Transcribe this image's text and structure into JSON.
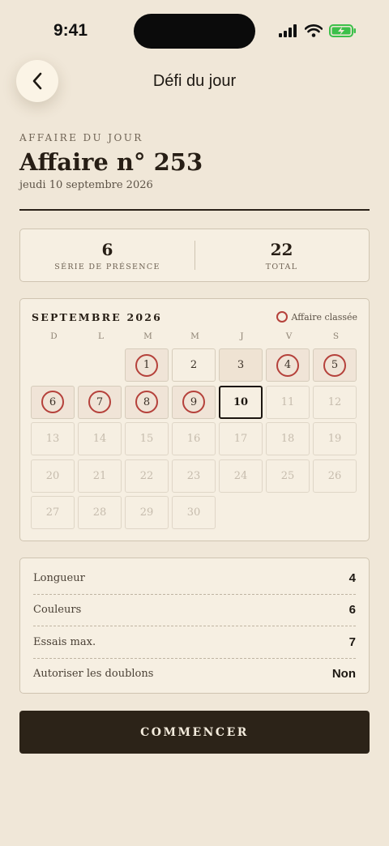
{
  "status_bar": {
    "time": "9:41"
  },
  "header": {
    "title": "Défi du jour"
  },
  "case": {
    "eyebrow": "AFFAIRE DU JOUR",
    "title": "Affaire n° 253",
    "date": "jeudi 10 septembre 2026"
  },
  "stats": [
    {
      "value": "6",
      "label": "SÉRIE DE PRÉSENCE"
    },
    {
      "value": "22",
      "label": "TOTAL"
    }
  ],
  "calendar": {
    "title": "SEPTEMBRE 2026",
    "legend": "Affaire classée",
    "weekdays": [
      "D",
      "L",
      "M",
      "M",
      "J",
      "V",
      "S"
    ],
    "leading_blanks": 2,
    "days": [
      {
        "n": "1",
        "state": "solved"
      },
      {
        "n": "2",
        "state": "normal"
      },
      {
        "n": "3",
        "state": "missed"
      },
      {
        "n": "4",
        "state": "solved"
      },
      {
        "n": "5",
        "state": "solved"
      },
      {
        "n": "6",
        "state": "solved"
      },
      {
        "n": "7",
        "state": "solved"
      },
      {
        "n": "8",
        "state": "solved"
      },
      {
        "n": "9",
        "state": "solved"
      },
      {
        "n": "10",
        "state": "today"
      },
      {
        "n": "11",
        "state": "future"
      },
      {
        "n": "12",
        "state": "future"
      },
      {
        "n": "13",
        "state": "future"
      },
      {
        "n": "14",
        "state": "future"
      },
      {
        "n": "15",
        "state": "future"
      },
      {
        "n": "16",
        "state": "future"
      },
      {
        "n": "17",
        "state": "future"
      },
      {
        "n": "18",
        "state": "future"
      },
      {
        "n": "19",
        "state": "future"
      },
      {
        "n": "20",
        "state": "future"
      },
      {
        "n": "21",
        "state": "future"
      },
      {
        "n": "22",
        "state": "future"
      },
      {
        "n": "23",
        "state": "future"
      },
      {
        "n": "24",
        "state": "future"
      },
      {
        "n": "25",
        "state": "future"
      },
      {
        "n": "26",
        "state": "future"
      },
      {
        "n": "27",
        "state": "future"
      },
      {
        "n": "28",
        "state": "future"
      },
      {
        "n": "29",
        "state": "future"
      },
      {
        "n": "30",
        "state": "future"
      }
    ]
  },
  "settings": [
    {
      "label": "Longueur",
      "value": "4"
    },
    {
      "label": "Couleurs",
      "value": "6"
    },
    {
      "label": "Essais max.",
      "value": "7"
    },
    {
      "label": "Autoriser les doublons",
      "value": "Non"
    }
  ],
  "cta": {
    "label": "COMMENCER"
  },
  "colors": {
    "background": "#f0e7d8",
    "ink": "#2c2318",
    "solved_ring": "#b5413b",
    "battery": "#3cc04a"
  }
}
